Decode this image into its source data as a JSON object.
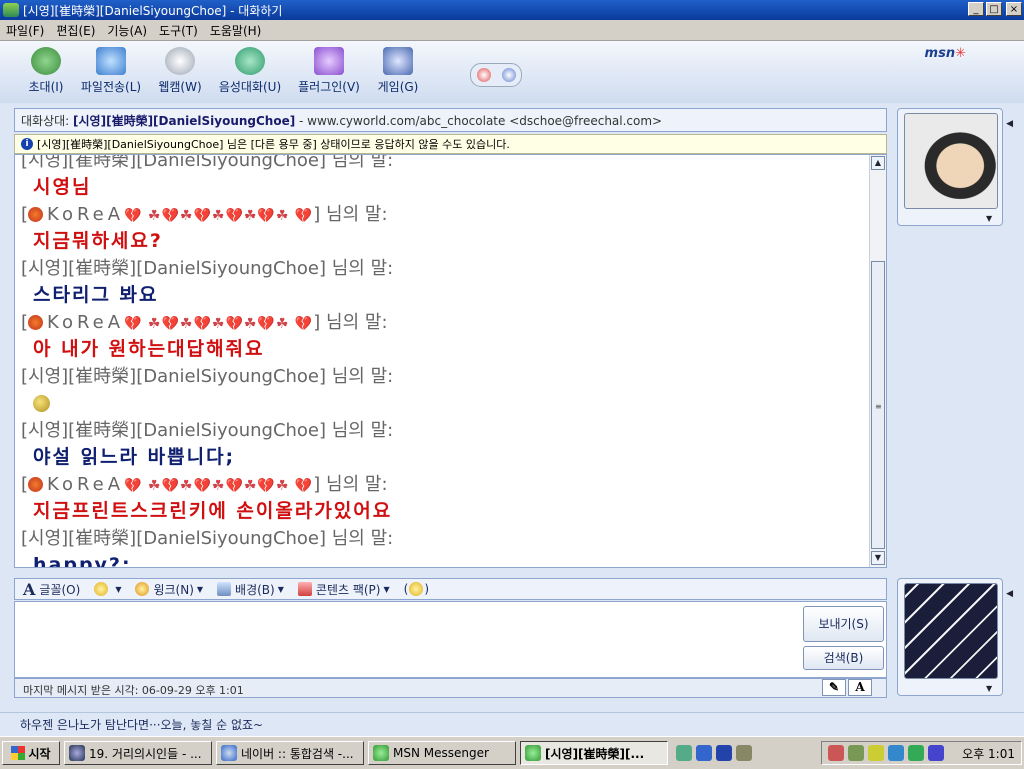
{
  "window": {
    "title": "[시영][崔時榮][DanielSiyoungChoe] - 대화하기",
    "controls": [
      "_",
      "□",
      "×"
    ]
  },
  "menu": [
    "파일(F)",
    "편집(E)",
    "기능(A)",
    "도구(T)",
    "도움말(H)"
  ],
  "toolbar": {
    "items": [
      {
        "label": "초대(I)",
        "icon": "invite-icon",
        "color": "#3a8a3a"
      },
      {
        "label": "파일전송(L)",
        "icon": "file-transfer-icon",
        "color": "#3e7fd0"
      },
      {
        "label": "웹캠(W)",
        "icon": "webcam-icon",
        "color": "#9aa4b2"
      },
      {
        "label": "음성대화(U)",
        "icon": "voice-chat-icon",
        "color": "#2c9a6a"
      },
      {
        "label": "플러그인(V)",
        "icon": "plugin-icon",
        "color": "#8a4fd0"
      },
      {
        "label": "게임(G)",
        "icon": "game-icon",
        "color": "#4a6ab0"
      }
    ],
    "brand": "msn"
  },
  "contact": {
    "prefix": "대화상대: ",
    "name": "[시영][崔時榮][DanielSiyoungChoe]",
    "suffix": " - www.cyworld.com/abc_chocolate <dschoe@freechal.com>"
  },
  "status_notice": "[시영][崔時榮][DanielSiyoungChoe] 님은 [다른 용무 중] 상태이므로 응답하지 않을 수도 있습니다.",
  "chat": {
    "speaker_me": "[시영][崔時榮][DanielSiyoungChoe] 님의 말:",
    "speaker_other_name": "KoReA",
    "speaker_other_hearts": "💔 ☘💔☘💔☘💔☘💔☘ 💔",
    "speaker_other_suffix": "] 님의 말:",
    "messages": [
      "시영님",
      "지금뭐하세요?",
      "스타리그 봐요",
      "아 내가 원하는대답해줘요",
      "야설 읽느라 바쁩니다;",
      "지금프린트스크린키에 손이올라가있어요",
      "happy?;"
    ]
  },
  "format_bar": {
    "font": "글꼴(O)",
    "wink": "윙크(N)",
    "background": "배경(B)",
    "content_pack": "콘텐츠 팩(P)"
  },
  "buttons": {
    "send": "보내기(S)",
    "search": "검색(B)"
  },
  "last_message": "마지막 메시지 받은 시각: 06-09-29 오후 1:01",
  "ad_text": "하우젠 은나노가 탐난다면···오늘, 놓칠 순 없죠~",
  "taskbar": {
    "start": "시작",
    "tasks": [
      {
        "label": "19. 거리의시인들 - ...",
        "icon": "media-player-icon",
        "active": false
      },
      {
        "label": "네이버 :: 통합검색 -...",
        "icon": "ie-icon",
        "active": false
      },
      {
        "label": "MSN Messenger",
        "icon": "msn-icon",
        "active": false
      },
      {
        "label": "[시영][崔時榮][...",
        "icon": "msn-chat-icon",
        "active": true
      }
    ],
    "clock": "오후 1:01"
  }
}
